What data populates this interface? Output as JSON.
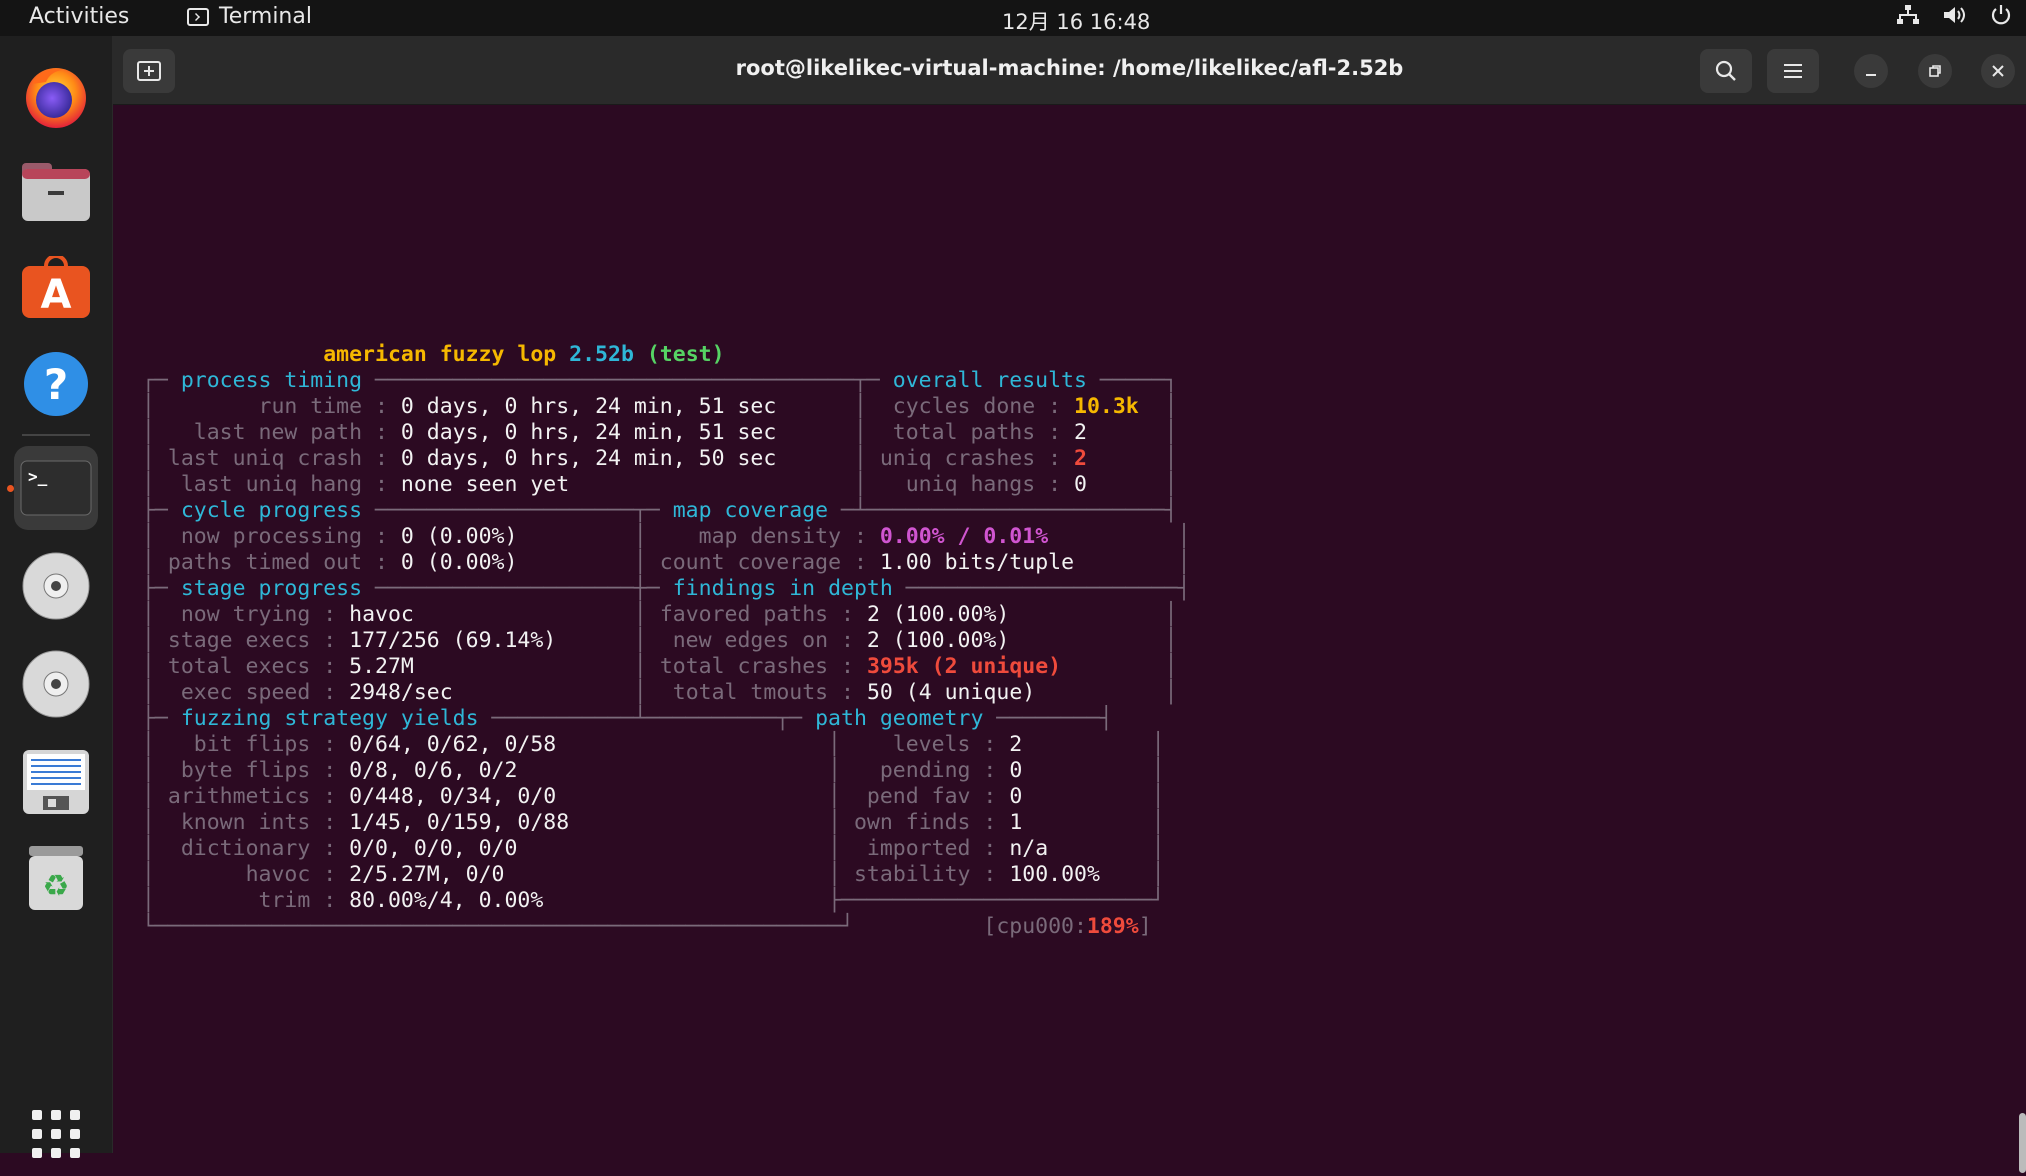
{
  "topbar": {
    "activities": "Activities",
    "app_name": "Terminal",
    "clock": "12月 16  16:48",
    "tray_icons": [
      "network-icon",
      "volume-icon",
      "power-icon"
    ]
  },
  "dock": {
    "items": [
      "firefox",
      "files",
      "app-center",
      "help",
      "terminal",
      "disc-drive",
      "disc-drive-2",
      "text-editor",
      "trash",
      "show-apps"
    ],
    "active": "terminal"
  },
  "window": {
    "title": "root@likelikec-virtual-machine: /home/likelikec/afl-2.52b"
  },
  "afl": {
    "banner_prefix": "american fuzzy lop ",
    "version": "2.52b",
    "target": "(test)",
    "process_timing": {
      "header": "process timing",
      "run_time_label": "run time",
      "run_time": "0 days, 0 hrs, 24 min, 51 sec",
      "last_new_path_label": "last new path",
      "last_new_path": "0 days, 0 hrs, 24 min, 51 sec",
      "last_uniq_crash_label": "last uniq crash",
      "last_uniq_crash": "0 days, 0 hrs, 24 min, 50 sec",
      "last_uniq_hang_label": "last uniq hang",
      "last_uniq_hang": "none seen yet"
    },
    "overall_results": {
      "header": "overall results",
      "cycles_done_label": "cycles done",
      "cycles_done": "10.3k",
      "total_paths_label": "total paths",
      "total_paths": "2",
      "uniq_crashes_label": "uniq crashes",
      "uniq_crashes": "2",
      "uniq_hangs_label": "uniq hangs",
      "uniq_hangs": "0"
    },
    "cycle_progress": {
      "header": "cycle progress",
      "now_processing_label": "now processing",
      "now_processing": "0 (0.00%)",
      "paths_timed_out_label": "paths timed out",
      "paths_timed_out": "0 (0.00%)"
    },
    "map_coverage": {
      "header": "map coverage",
      "map_density_label": "map density",
      "map_density": "0.00% / 0.01%",
      "count_coverage_label": "count coverage",
      "count_coverage": "1.00 bits/tuple"
    },
    "stage_progress": {
      "header": "stage progress",
      "now_trying_label": "now trying",
      "now_trying": "havoc",
      "stage_execs_label": "stage execs",
      "stage_execs": "177/256 (69.14%)",
      "total_execs_label": "total execs",
      "total_execs": "5.27M",
      "exec_speed_label": "exec speed",
      "exec_speed": "2948/sec"
    },
    "findings_in_depth": {
      "header": "findings in depth",
      "favored_paths_label": "favored paths",
      "favored_paths": "2 (100.00%)",
      "new_edges_on_label": "new edges on",
      "new_edges_on": "2 (100.00%)",
      "total_crashes_label": "total crashes",
      "total_crashes": "395k (2 unique)",
      "total_tmouts_label": "total tmouts",
      "total_tmouts": "50 (4 unique)"
    },
    "fuzzing_strategy_yields": {
      "header": "fuzzing strategy yields",
      "bit_flips_label": "bit flips",
      "bit_flips": "0/64, 0/62, 0/58",
      "byte_flips_label": "byte flips",
      "byte_flips": "0/8, 0/6, 0/2",
      "arithmetics_label": "arithmetics",
      "arithmetics": "0/448, 0/34, 0/0",
      "known_ints_label": "known ints",
      "known_ints": "1/45, 0/159, 0/88",
      "dictionary_label": "dictionary",
      "dictionary": "0/0, 0/0, 0/0",
      "havoc_label": "havoc",
      "havoc": "2/5.27M, 0/0",
      "trim_label": "trim",
      "trim": "80.00%/4, 0.00%"
    },
    "path_geometry": {
      "header": "path geometry",
      "levels_label": "levels",
      "levels": "2",
      "pending_label": "pending",
      "pending": "0",
      "pend_fav_label": "pend fav",
      "pend_fav": "0",
      "own_finds_label": "own finds",
      "own_finds": "1",
      "imported_label": "imported",
      "imported": "n/a",
      "stability_label": "stability",
      "stability": "100.00%"
    },
    "cpu": {
      "label": "cpu000:",
      "value": "189%"
    }
  }
}
